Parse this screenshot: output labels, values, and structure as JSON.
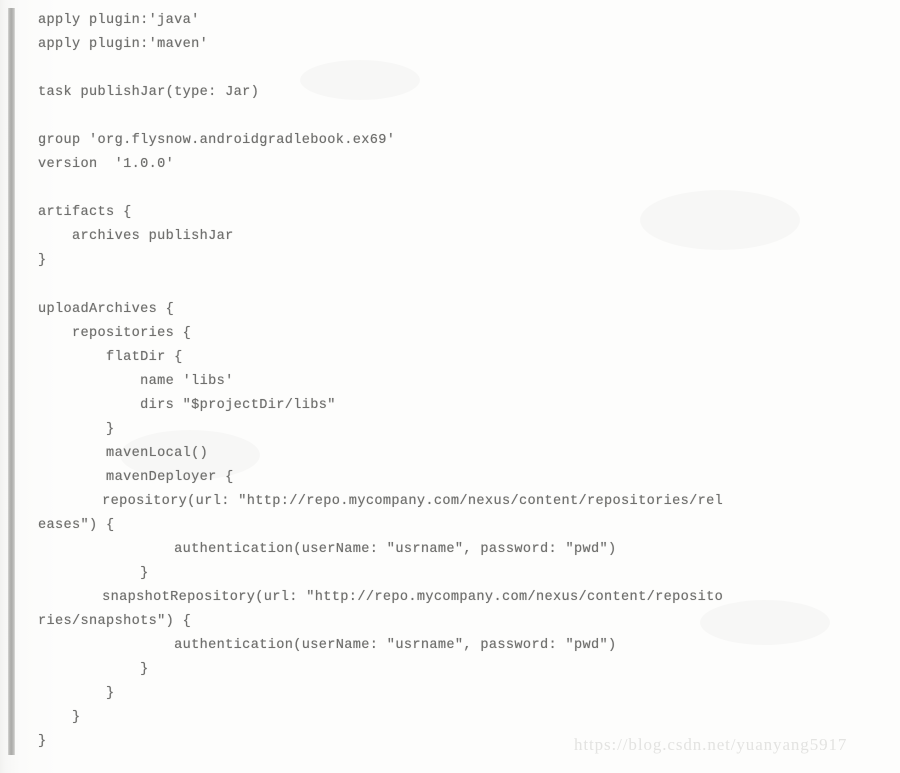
{
  "document": {
    "kind": "scanned-code-listing",
    "language": "gradle",
    "background_color": "#fdfdfc",
    "text_color": "#6f6f6d",
    "gutter_bar_color": "#9d9d9a"
  },
  "code": {
    "lines": [
      "apply plugin:'java'",
      "apply plugin:'maven'",
      "",
      "task publishJar(type: Jar)",
      "",
      "group 'org.flysnow.androidgradlebook.ex69'",
      "version  '1.0.0'",
      "",
      "artifacts {",
      "    archives publishJar",
      "}",
      "",
      "uploadArchives {",
      "    repositories {",
      "        flatDir {",
      "            name 'libs'",
      "            dirs \"$projectDir/libs\"",
      "        }",
      "        mavenLocal()",
      "        mavenDeployer {",
      "            repository(url: \"http://repo.mycompany.com/nexus/content/repositories/rel",
      "eases\") {",
      "                authentication(userName: \"usrname\", password: \"pwd\")",
      "            }",
      "            snapshotRepository(url: \"http://repo.mycompany.com/nexus/content/reposito",
      "ries/snapshots\") {",
      "                authentication(userName: \"usrname\", password: \"pwd\")",
      "            }",
      "        }",
      "    }",
      "}"
    ],
    "wrapped_line_indices": [
      20,
      24
    ]
  },
  "watermark": {
    "text": "https://blog.csdn.net/yuanyang5917",
    "color": "#e3e3e1"
  }
}
